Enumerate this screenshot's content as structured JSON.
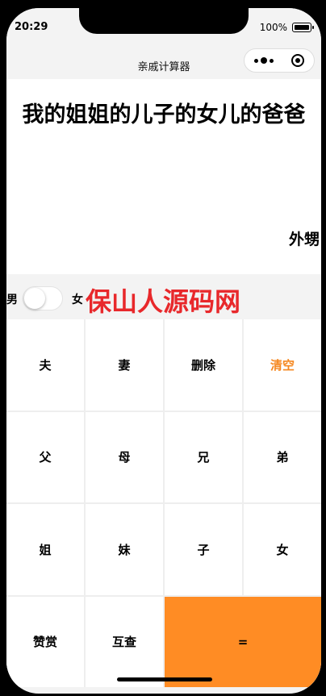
{
  "status_bar": {
    "time": "20:29",
    "battery": "100%"
  },
  "header": {
    "title": "亲戚计算器"
  },
  "display": {
    "expression": "我的姐姐的儿子的女儿的爸爸",
    "result": "外甥"
  },
  "gender": {
    "male_label": "男",
    "female_label": "女",
    "watermark": "保山人源码网"
  },
  "keys": {
    "row1": [
      "夫",
      "妻",
      "删除",
      "清空"
    ],
    "row2": [
      "父",
      "母",
      "兄",
      "弟"
    ],
    "row3": [
      "姐",
      "妹",
      "子",
      "女"
    ],
    "row4": [
      "赞赏",
      "互查",
      "="
    ]
  },
  "colors": {
    "accent": "#ff8c24",
    "clear_text": "#f5871f",
    "watermark": "#e8282b"
  }
}
